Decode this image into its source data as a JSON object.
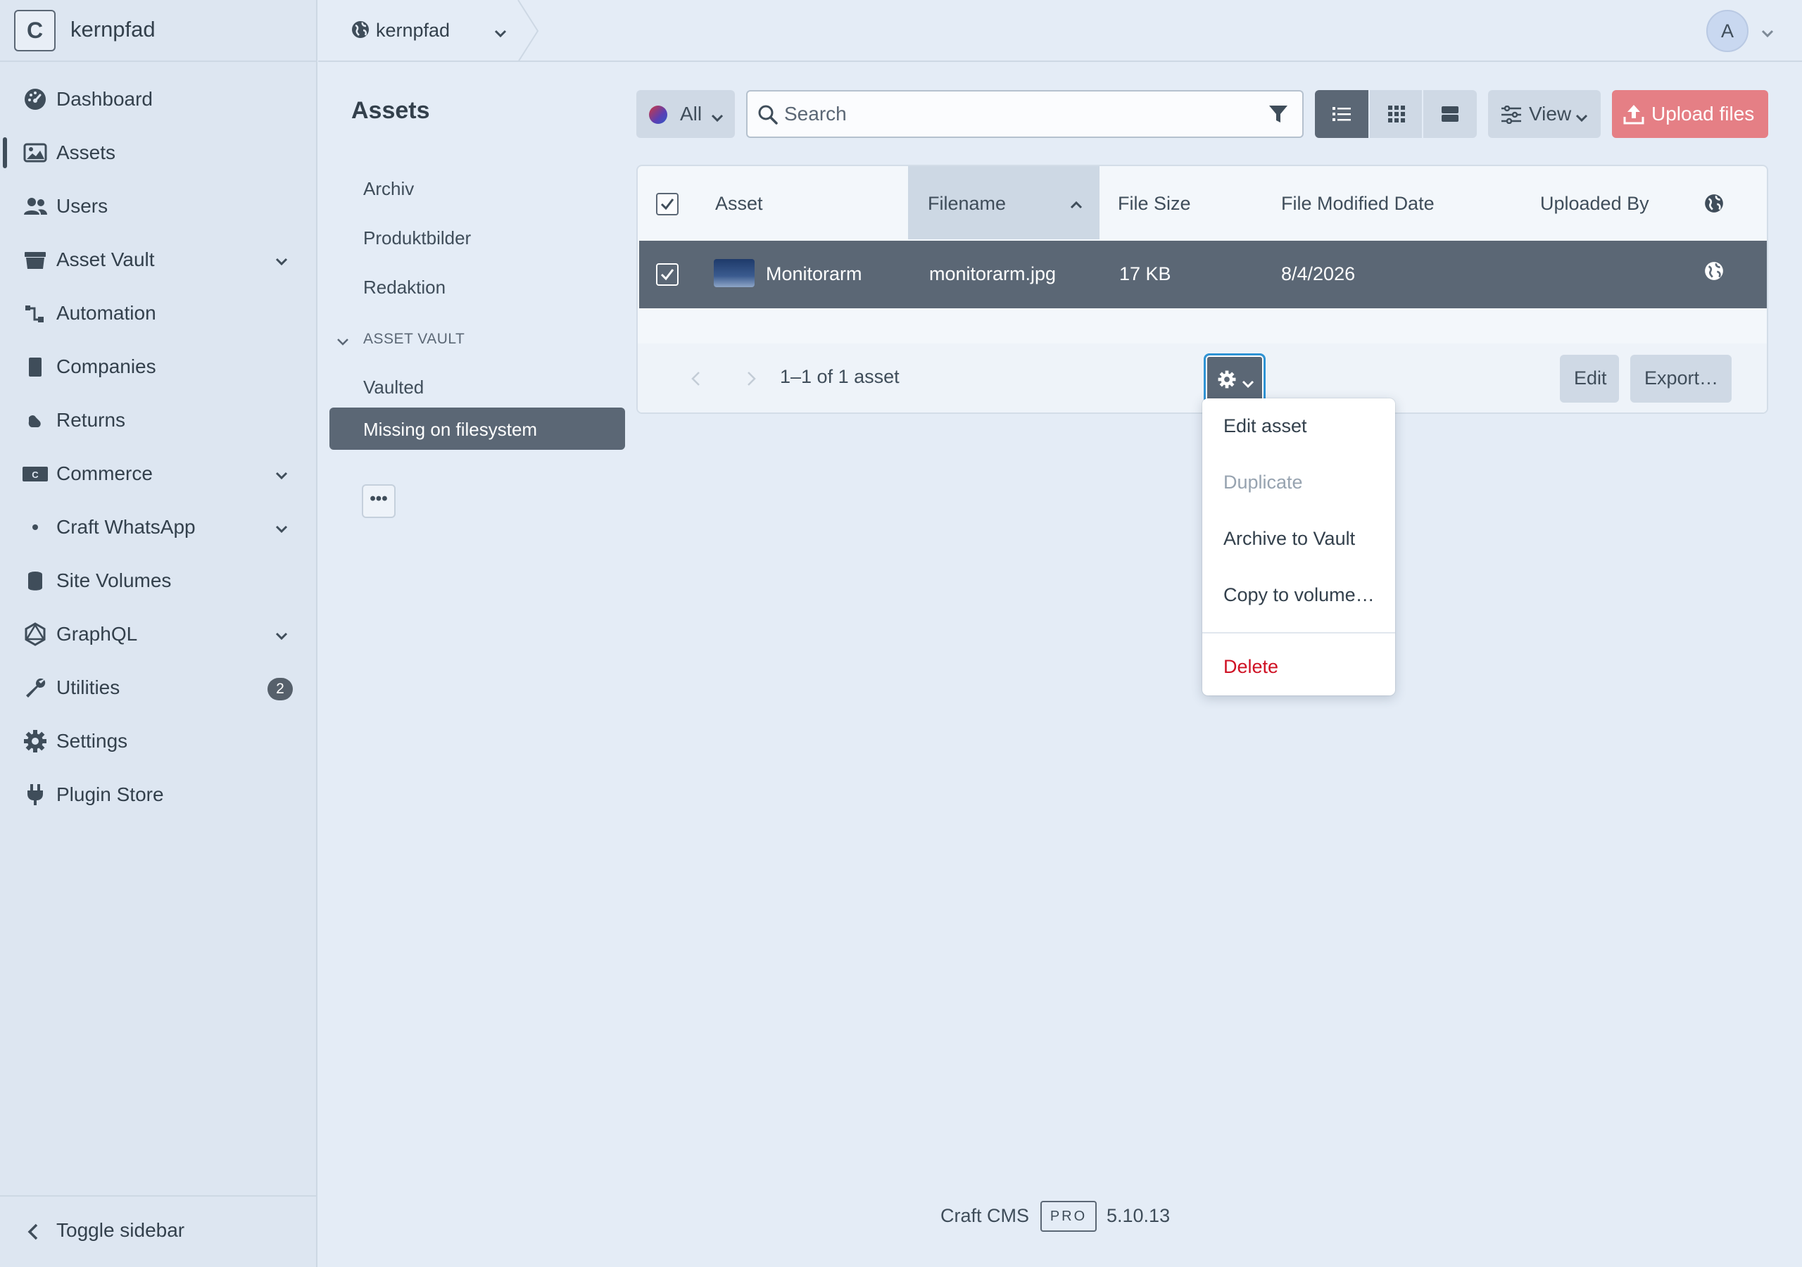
{
  "brand": {
    "logo_letter": "C",
    "name": "kernpfad"
  },
  "sidebar": {
    "items": [
      {
        "label": "Dashboard",
        "icon": "dashboard-icon"
      },
      {
        "label": "Assets",
        "icon": "image-icon",
        "active": true
      },
      {
        "label": "Users",
        "icon": "users-icon"
      },
      {
        "label": "Asset Vault",
        "icon": "archive-box-icon",
        "expandable": true
      },
      {
        "label": "Automation",
        "icon": "flow-icon"
      },
      {
        "label": "Companies",
        "icon": "building-icon"
      },
      {
        "label": "Returns",
        "icon": "return-icon"
      },
      {
        "label": "Commerce",
        "icon": "commerce-icon",
        "expandable": true
      },
      {
        "label": "Craft WhatsApp",
        "icon": "dot-icon",
        "expandable": true
      },
      {
        "label": "Site Volumes",
        "icon": "database-icon"
      },
      {
        "label": "GraphQL",
        "icon": "graphql-icon",
        "expandable": true
      },
      {
        "label": "Utilities",
        "icon": "wrench-icon",
        "badge": "2"
      },
      {
        "label": "Settings",
        "icon": "gear-icon"
      },
      {
        "label": "Plugin Store",
        "icon": "plug-icon"
      }
    ],
    "toggle_label": "Toggle sidebar"
  },
  "header": {
    "site_label": "kernpfad",
    "avatar_letter": "A"
  },
  "page": {
    "title": "Assets"
  },
  "sources": {
    "items": [
      "Archiv",
      "Produktbilder",
      "Redaktion"
    ],
    "group_heading": "ASSET VAULT",
    "group_items": [
      "Vaulted",
      "Missing on filesystem"
    ],
    "selected": "Missing on filesystem",
    "more_label": "•••"
  },
  "toolbar": {
    "site_filter_label": "All",
    "search_placeholder": "Search",
    "view_label": "View",
    "upload_label": "Upload files"
  },
  "table": {
    "columns": [
      "Asset",
      "Filename",
      "File Size",
      "File Modified Date",
      "Uploaded By"
    ],
    "sorted_column": "Filename",
    "rows": [
      {
        "title": "Monitorarm",
        "filename": "monitorarm.jpg",
        "size": "17 KB",
        "modified": "8/4/2026",
        "uploaded_by": "",
        "selected": true
      }
    ],
    "pagination": "1–1 of 1 asset",
    "edit_label": "Edit",
    "export_label": "Export…"
  },
  "action_menu": {
    "items": [
      {
        "label": "Edit asset",
        "state": "normal"
      },
      {
        "label": "Duplicate",
        "state": "disabled"
      },
      {
        "label": "Archive to Vault",
        "state": "normal"
      },
      {
        "label": "Copy to volume…",
        "state": "normal"
      },
      {
        "label": "Delete",
        "state": "danger"
      }
    ]
  },
  "footer": {
    "name": "Craft CMS",
    "edition": "PRO",
    "version": "5.10.13"
  },
  "colors": {
    "accent": "#e57f85",
    "selected_row": "#5b6775",
    "danger": "#cf1124",
    "focus_ring": "#2f93d4"
  }
}
